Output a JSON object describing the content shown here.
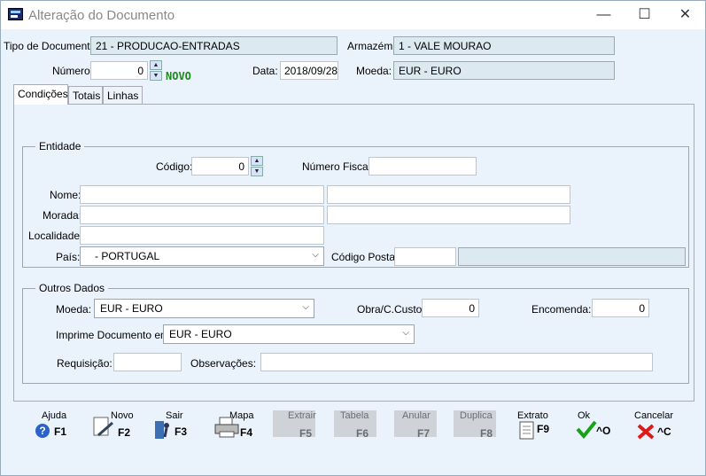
{
  "window": {
    "title": "Alteração do Documento",
    "minimize": "—",
    "maximize": "☐",
    "close": "✕"
  },
  "header": {
    "tipo_label": "Tipo de Documento:",
    "tipo_value": "21 - PRODUCAO-ENTRADAS",
    "armazem_label": "Armazém:",
    "armazem_value": "1 - VALE MOURAO",
    "numero_label": "Número:",
    "numero_value": "0",
    "novo": "NOVO",
    "data_label": "Data:",
    "data_value": "2018/09/28",
    "moeda_label": "Moeda:",
    "moeda_value": "EUR - EURO"
  },
  "tabs": [
    "Condições",
    "Totais",
    "Linhas"
  ],
  "entidade": {
    "title": "Entidade",
    "codigo_label": "Código:",
    "codigo_value": "0",
    "nif_label": "Número Fiscal:",
    "nif_value": "",
    "nome_label": "Nome:",
    "morada_label": "Morada:",
    "localidade_label": "Localidade:",
    "pais_label": "País:",
    "pais_value": "- PORTUGAL",
    "cp_label": "Código Postal:"
  },
  "outros": {
    "title": "Outros Dados",
    "moeda_label": "Moeda:",
    "moeda_value": "EUR - EURO",
    "obra_label": "Obra/C.Custo",
    "obra_value": "0",
    "encomenda_label": "Encomenda:",
    "encomenda_value": "0",
    "imprime_label": "Imprime Documento em:",
    "imprime_value": "EUR - EURO",
    "requisicao_label": "Requisição:",
    "observacoes_label": "Observações:"
  },
  "toolbar": {
    "ajuda": "Ajuda",
    "ajuda_key": "F1",
    "novo": "Novo",
    "novo_key": "F2",
    "sair": "Sair",
    "sair_key": "F3",
    "mapa": "Mapa",
    "mapa_key": "F4",
    "f5_label": "Extrair",
    "f5_key": "F5",
    "f6_label": "Tabela",
    "f6_key": "F6",
    "f7_label": "Anular",
    "f7_key": "F7",
    "f8_label": "Duplica",
    "f8_key": "F8",
    "extrato": "Extrato",
    "extrato_key": "F9",
    "ok": "Ok",
    "ok_key": "^O",
    "cancelar": "Cancelar",
    "cancelar_key": "^C"
  }
}
